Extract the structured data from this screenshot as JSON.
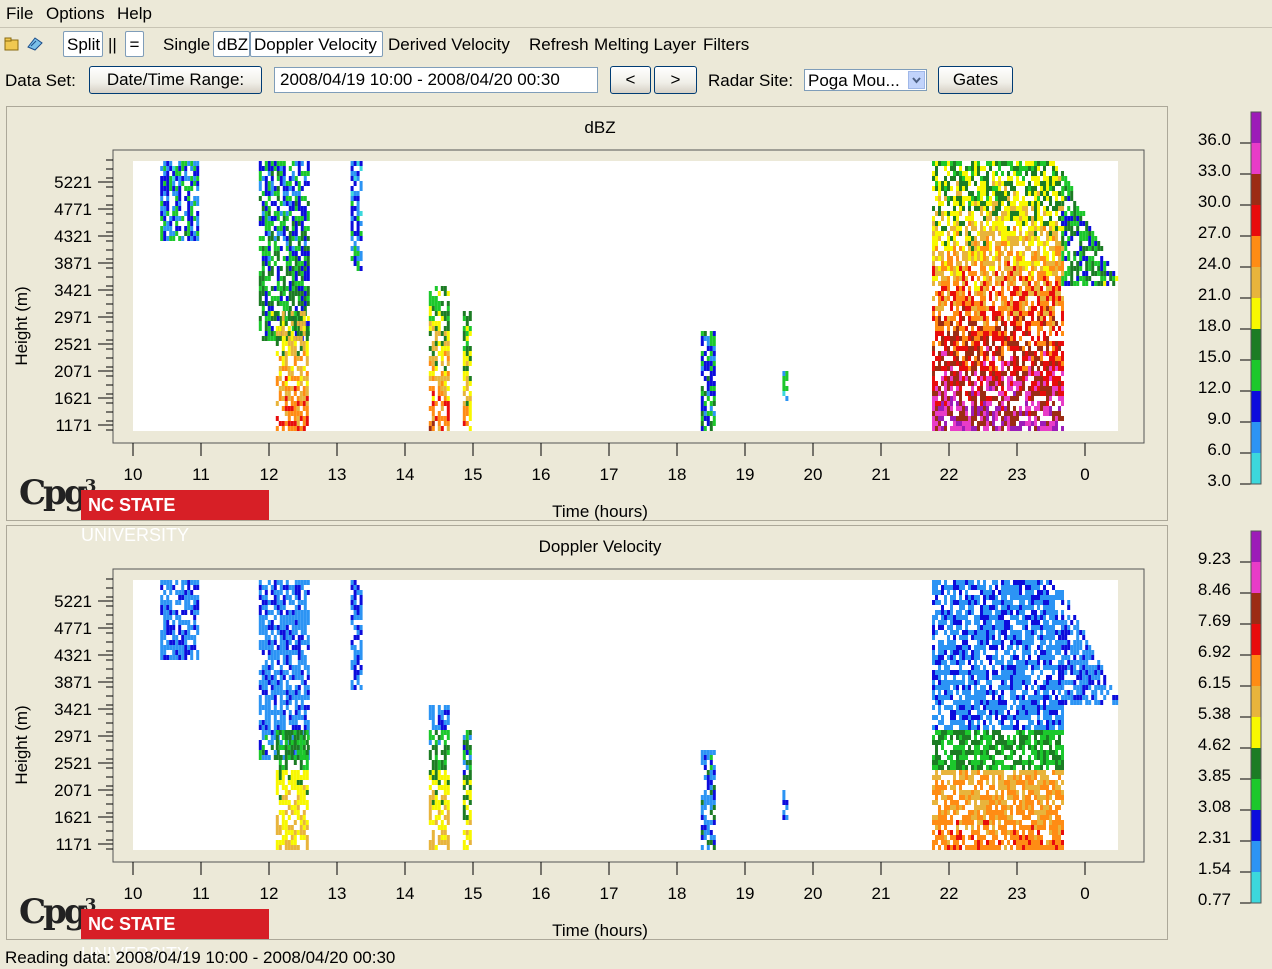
{
  "menu": [
    "File",
    "Options",
    "Help"
  ],
  "toolbar": {
    "split": "Split",
    "parallel": "||",
    "equal": "=",
    "single": "Single",
    "dbz": "dBZ",
    "doppler": "Doppler Velocity",
    "derived": "Derived Velocity",
    "refresh": "Refresh",
    "melting": "Melting Layer",
    "filters": "Filters"
  },
  "dataset": {
    "label": "Data Set:",
    "range_button": "Date/Time Range:",
    "range_value": "2008/04/19 10:00 - 2008/04/20 00:30",
    "prev": "<",
    "next": ">",
    "site_label": "Radar Site:",
    "site_value": "Poga Mou...",
    "gates": "Gates"
  },
  "plots": [
    {
      "title": "dBZ",
      "ylabel": "Height (m)",
      "xlabel": "Time (hours)",
      "yticks": [
        "5221",
        "4771",
        "4321",
        "3871",
        "3421",
        "2971",
        "2521",
        "2071",
        "1621",
        "1171"
      ],
      "xticks": [
        "10",
        "11",
        "12",
        "13",
        "14",
        "15",
        "16",
        "17",
        "18",
        "19",
        "20",
        "21",
        "22",
        "23",
        "0"
      ],
      "scale": [
        "36.0",
        "33.0",
        "30.0",
        "27.0",
        "24.0",
        "21.0",
        "18.0",
        "15.0",
        "12.0",
        "9.0",
        "6.0",
        "3.0"
      ]
    },
    {
      "title": "Doppler Velocity",
      "ylabel": "Height (m)",
      "xlabel": "Time (hours)",
      "yticks": [
        "5221",
        "4771",
        "4321",
        "3871",
        "3421",
        "2971",
        "2521",
        "2071",
        "1621",
        "1171"
      ],
      "xticks": [
        "10",
        "11",
        "12",
        "13",
        "14",
        "15",
        "16",
        "17",
        "18",
        "19",
        "20",
        "21",
        "22",
        "23",
        "0"
      ],
      "scale": [
        "9.23",
        "8.46",
        "7.69",
        "6.92",
        "6.15",
        "5.38",
        "4.62",
        "3.85",
        "3.08",
        "2.31",
        "1.54",
        "0.77"
      ]
    }
  ],
  "colors": {
    "scale": [
      "#9c1cb8",
      "#e83cc8",
      "#9c2c14",
      "#e80c0c",
      "#ff8c14",
      "#e8b43c",
      "#f8f800",
      "#1c7c24",
      "#1cc82c",
      "#0c0cdc",
      "#2c94f4",
      "#3cd8dc"
    ]
  },
  "branding": {
    "cpg": "Cpg",
    "cpg_sup": "3",
    "ncsu_bold": "NC STATE",
    "ncsu_light": "UNIVERSITY"
  },
  "status": "Reading data: 2008/04/19 10:00 - 2008/04/20 00:30"
}
